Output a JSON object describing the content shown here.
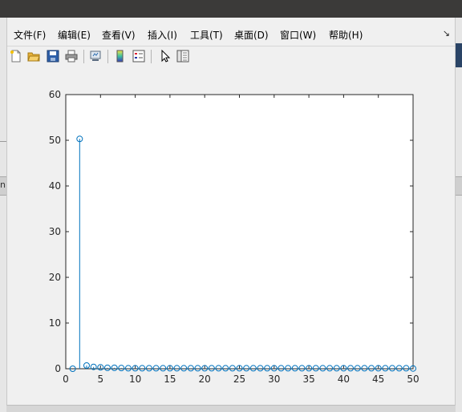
{
  "menu": {
    "items": [
      "文件(F)",
      "编辑(E)",
      "查看(V)",
      "插入(I)",
      "工具(T)",
      "桌面(D)",
      "窗口(W)",
      "帮助(H)"
    ],
    "more": "↘"
  },
  "toolbar": {
    "icons": [
      "new-figure-icon",
      "open-file-icon",
      "save-icon",
      "print-icon",
      "link-plot-icon",
      "insert-colorbar-icon",
      "insert-legend-icon",
      "edit-plot-arrow-icon",
      "property-inspector-icon"
    ]
  },
  "desktop": {
    "left_char": "n"
  },
  "chart_data": {
    "type": "stem",
    "title": "",
    "xlabel": "",
    "ylabel": "",
    "xlim": [
      0,
      50
    ],
    "ylim": [
      0,
      60
    ],
    "xticks": [
      "0",
      "5",
      "10",
      "15",
      "20",
      "25",
      "30",
      "35",
      "40",
      "45",
      "50"
    ],
    "yticks": [
      "0",
      "10",
      "20",
      "30",
      "40",
      "50",
      "60"
    ],
    "grid": false,
    "x": [
      1,
      2,
      3,
      4,
      5,
      6,
      7,
      8,
      9,
      10,
      11,
      12,
      13,
      14,
      15,
      16,
      17,
      18,
      19,
      20,
      21,
      22,
      23,
      24,
      25,
      26,
      27,
      28,
      29,
      30,
      31,
      32,
      33,
      34,
      35,
      36,
      37,
      38,
      39,
      40,
      41,
      42,
      43,
      44,
      45,
      46,
      47,
      48,
      49,
      50
    ],
    "values": [
      0,
      50.3,
      0.7,
      0.4,
      0.3,
      0.2,
      0.2,
      0.15,
      0.1,
      0.1,
      0.1,
      0.1,
      0.1,
      0.1,
      0.1,
      0.1,
      0.1,
      0.1,
      0.1,
      0.1,
      0.1,
      0.1,
      0.1,
      0.1,
      0.1,
      0.1,
      0.1,
      0.1,
      0.1,
      0.1,
      0.1,
      0.1,
      0.1,
      0.1,
      0.1,
      0.1,
      0.1,
      0.1,
      0.1,
      0.1,
      0.1,
      0.1,
      0.1,
      0.1,
      0.1,
      0.1,
      0.1,
      0.1,
      0.1,
      0.05
    ],
    "color": "#0072bd"
  }
}
